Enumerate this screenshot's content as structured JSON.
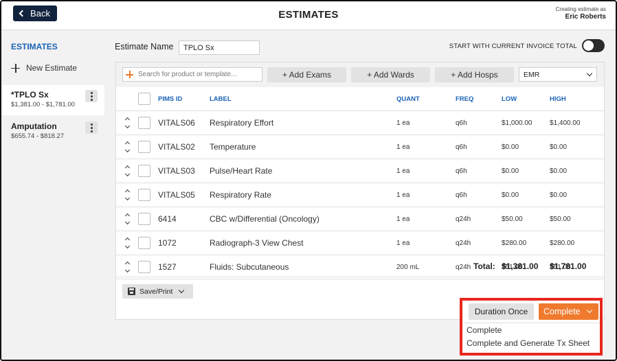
{
  "header": {
    "back_label": "Back",
    "title": "ESTIMATES",
    "creating_as": "Creating estimate as",
    "user_name": "Eric Roberts"
  },
  "sidebar": {
    "heading": "ESTIMATES",
    "new_estimate": "New Estimate",
    "items": [
      {
        "name": "*TPLO Sx",
        "range": "$1,381.00 - $1,781.00",
        "active": true
      },
      {
        "name": "Amputation",
        "range": "$655.74 - $818.27",
        "active": false
      }
    ]
  },
  "form": {
    "estimate_name_label": "Estimate Name",
    "estimate_name_value": "TPLO Sx",
    "start_toggle_label": "START WITH CURRENT INVOICE TOTAL",
    "start_toggle_on": false
  },
  "toolbar": {
    "search_placeholder": "Search for product or template...",
    "add_exams": "+ Add Exams",
    "add_wards": "+ Add Wards",
    "add_hosps": "+ Add Hosps",
    "select_value": "EMR"
  },
  "table": {
    "columns": [
      "PIMS ID",
      "LABEL",
      "QUANT",
      "FREQ",
      "LOW",
      "HIGH"
    ],
    "rows": [
      {
        "pims": "VITALS06",
        "label": "Respiratory Effort",
        "quant": "1 ea",
        "freq": "q6h",
        "low": "$1,000.00",
        "high": "$1,400.00"
      },
      {
        "pims": "VITALS02",
        "label": "Temperature",
        "quant": "1 ea",
        "freq": "q6h",
        "low": "$0.00",
        "high": "$0.00"
      },
      {
        "pims": "VITALS03",
        "label": "Pulse/Heart Rate",
        "quant": "1 ea",
        "freq": "q6h",
        "low": "$0.00",
        "high": "$0.00"
      },
      {
        "pims": "VITALS05",
        "label": "Respiratory Rate",
        "quant": "1 ea",
        "freq": "q6h",
        "low": "$0.00",
        "high": "$0.00"
      },
      {
        "pims": "6414",
        "label": "CBC w/Differential (Oncology)",
        "quant": "1 ea",
        "freq": "q24h",
        "low": "$50.00",
        "high": "$50.00"
      },
      {
        "pims": "1072",
        "label": "Radiograph-3 View Chest",
        "quant": "1 ea",
        "freq": "q24h",
        "low": "$280.00",
        "high": "$280.00"
      },
      {
        "pims": "1527",
        "label": "Fluids: Subcutaneous",
        "quant": "200 mL",
        "freq": "q24h",
        "low": "$51.00",
        "high": "$51.00"
      }
    ],
    "total_label": "Total:",
    "total_low": "$1,381.00",
    "total_high": "$1,781.00"
  },
  "footer": {
    "save_print": "Save/Print",
    "duration": "Duration Once",
    "complete": "Complete",
    "menu": [
      "Complete",
      "Complete and Generate Tx Sheet"
    ]
  },
  "colors": {
    "navy": "#12233d",
    "link_blue": "#1b63b6",
    "orange": "#ef7a2e",
    "highlight_red": "#e8261d"
  }
}
